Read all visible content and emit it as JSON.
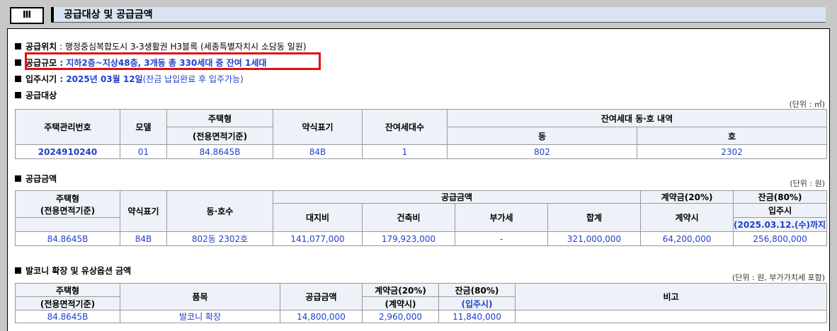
{
  "header": {
    "section_num": "Ⅲ",
    "title": "공급대상 및 공급금액"
  },
  "info": {
    "location_label": "공급위치",
    "location_value": " : 행정중심복합도시 3-3생활권 H3블록 (세종특별자치시 소담동 일원)",
    "scale_label": "공급규모",
    "scale_value": " : 지하2층~지상48층, 3개동 총 330세대 중 잔여 1세대",
    "movein_label": "입주시기",
    "movein_value": " : 2025년 03월 12일",
    "movein_note": "(잔금 납입완료 후 입주가능)"
  },
  "supply_target": {
    "title": "공급대상",
    "unit": "(단위 : ㎡)",
    "headers": {
      "mgmt_no": "주택관리번호",
      "model": "모델",
      "type": "주택형",
      "type_sub": "(전용면적기준)",
      "abbr": "약식표기",
      "remaining": "잔여세대수",
      "detail": "잔여세대 동·호 내역",
      "dong": "동",
      "ho": "호"
    },
    "row": {
      "mgmt_no": "2024910240",
      "model": "01",
      "type": "84.8645B",
      "abbr": "84B",
      "remaining": "1",
      "dong": "802",
      "ho": "2302"
    }
  },
  "supply_price": {
    "title": "공급금액",
    "unit": "(단위 : 원)",
    "headers": {
      "type": "주택형",
      "type_sub": "(전용면적기준)",
      "abbr": "약식표기",
      "unit_no": "동·호수",
      "price": "공급금액",
      "land": "대지비",
      "building": "건축비",
      "vat": "부가세",
      "total": "합계",
      "deposit": "계약금(20%)",
      "deposit_sub": "계약시",
      "balance": "잔금(80%)",
      "balance_sub": "입주시",
      "balance_date": "(2025.03.12.(수)까지)"
    },
    "row": {
      "type": "84.8645B",
      "abbr": "84B",
      "unit_no": "802동 2302호",
      "land": "141,077,000",
      "building": "179,923,000",
      "vat": "-",
      "total": "321,000,000",
      "deposit": "64,200,000",
      "balance": "256,800,000"
    }
  },
  "balcony": {
    "title": "발코니 확장 및 유상옵션 금액",
    "unit": "(단위 : 원, 부가가치세 포함)",
    "headers": {
      "type": "주택형",
      "type_sub": "(전용면적기준)",
      "item": "품목",
      "price": "공급금액",
      "deposit": "계약금(20%)",
      "deposit_sub": "(계약시)",
      "balance": "잔금(80%)",
      "balance_sub": "(입주시)",
      "note": "비고"
    },
    "row": {
      "type": "84.8645B",
      "item": "발코니 확장",
      "price": "14,800,000",
      "deposit": "2,960,000",
      "balance": "11,840,000",
      "note": ""
    }
  }
}
